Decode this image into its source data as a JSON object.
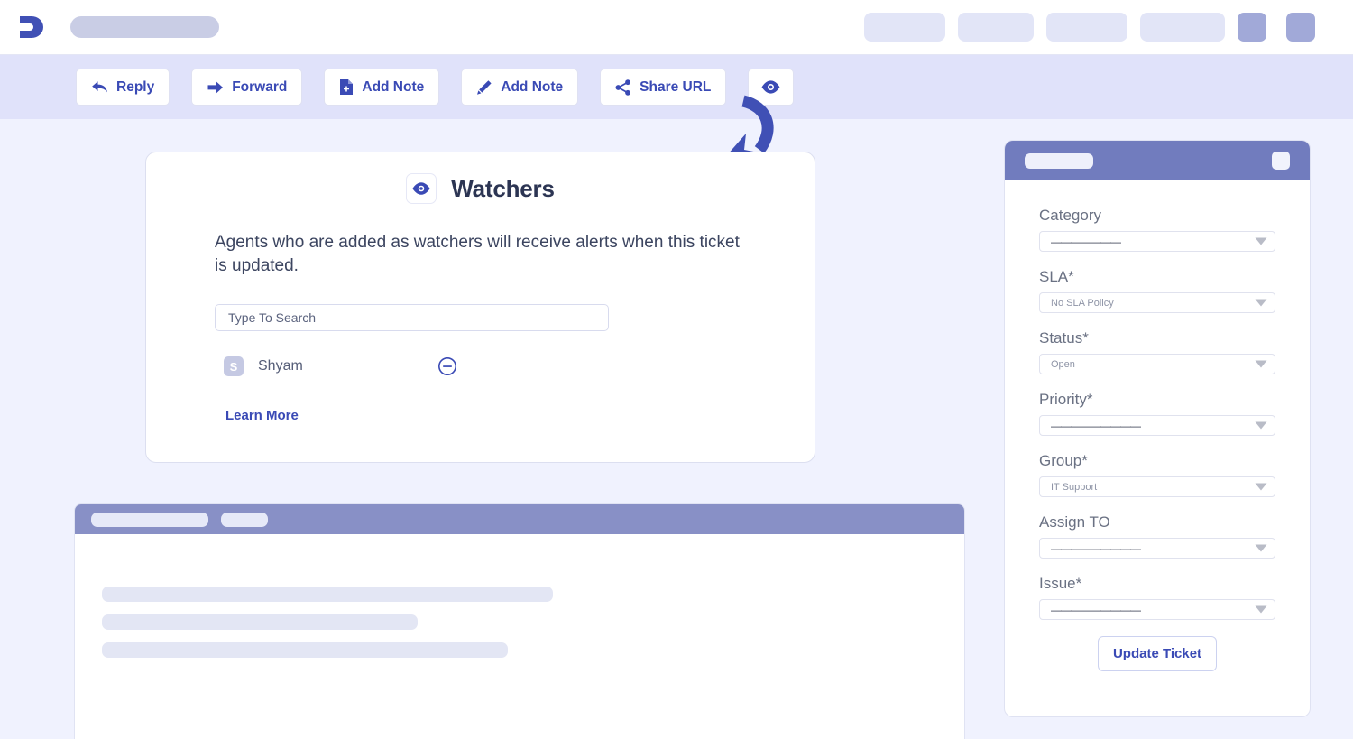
{
  "header": {
    "logo_icon": "app-logo-icon",
    "title_placeholder": "",
    "nav_placeholders": [
      "",
      "",
      "",
      ""
    ],
    "action_icons": [
      "",
      ""
    ]
  },
  "toolbar": {
    "buttons": [
      {
        "label": "Reply",
        "icon": "reply-arrow-icon"
      },
      {
        "label": "Forward",
        "icon": "forward-arrow-icon"
      },
      {
        "label": "Add Note",
        "icon": "document-plus-icon"
      },
      {
        "label": "Add Note",
        "icon": "pencil-icon"
      },
      {
        "label": "Share URL",
        "icon": "share-icon"
      }
    ],
    "watch_button": {
      "label": "",
      "icon": "eye-icon"
    }
  },
  "annotation": {
    "arrow_icon": "curved-arrow-icon",
    "color": "#4050b5"
  },
  "watchers": {
    "icon": "eye-icon",
    "title": "Watchers",
    "description": "Agents who are added as watchers will receive alerts when this ticket is updated.",
    "search_placeholder": "Type To Search",
    "search_value": "",
    "list": [
      {
        "initial": "S",
        "name": "Shyam",
        "remove_icon": "minus-circle-icon"
      }
    ],
    "learn_more": "Learn More"
  },
  "ticket_panel": {
    "header_placeholder": "",
    "header_action": "",
    "fields": [
      {
        "label": "Category",
        "value": "———————",
        "is_dash": true
      },
      {
        "label": "SLA*",
        "value": "No SLA Policy",
        "is_dash": false
      },
      {
        "label": "Status*",
        "value": "Open",
        "is_dash": false
      },
      {
        "label": "Priority*",
        "value": "—————————",
        "is_dash": true
      },
      {
        "label": "Group*",
        "value": "IT Support",
        "is_dash": false
      },
      {
        "label": "Assign TO",
        "value": "—————————",
        "is_dash": true
      },
      {
        "label": "Issue*",
        "value": "—————————",
        "is_dash": true
      }
    ],
    "submit_label": "Update Ticket"
  },
  "bottom_panel": {
    "tab_placeholder": "",
    "badge_placeholder": ""
  },
  "colors": {
    "accent": "#3a4ab5",
    "toolbar_bg": "#e0e2fa",
    "page_bg": "#f0f2fe",
    "panel_header": "#717cbe",
    "skeleton": "#e3e6f4"
  }
}
